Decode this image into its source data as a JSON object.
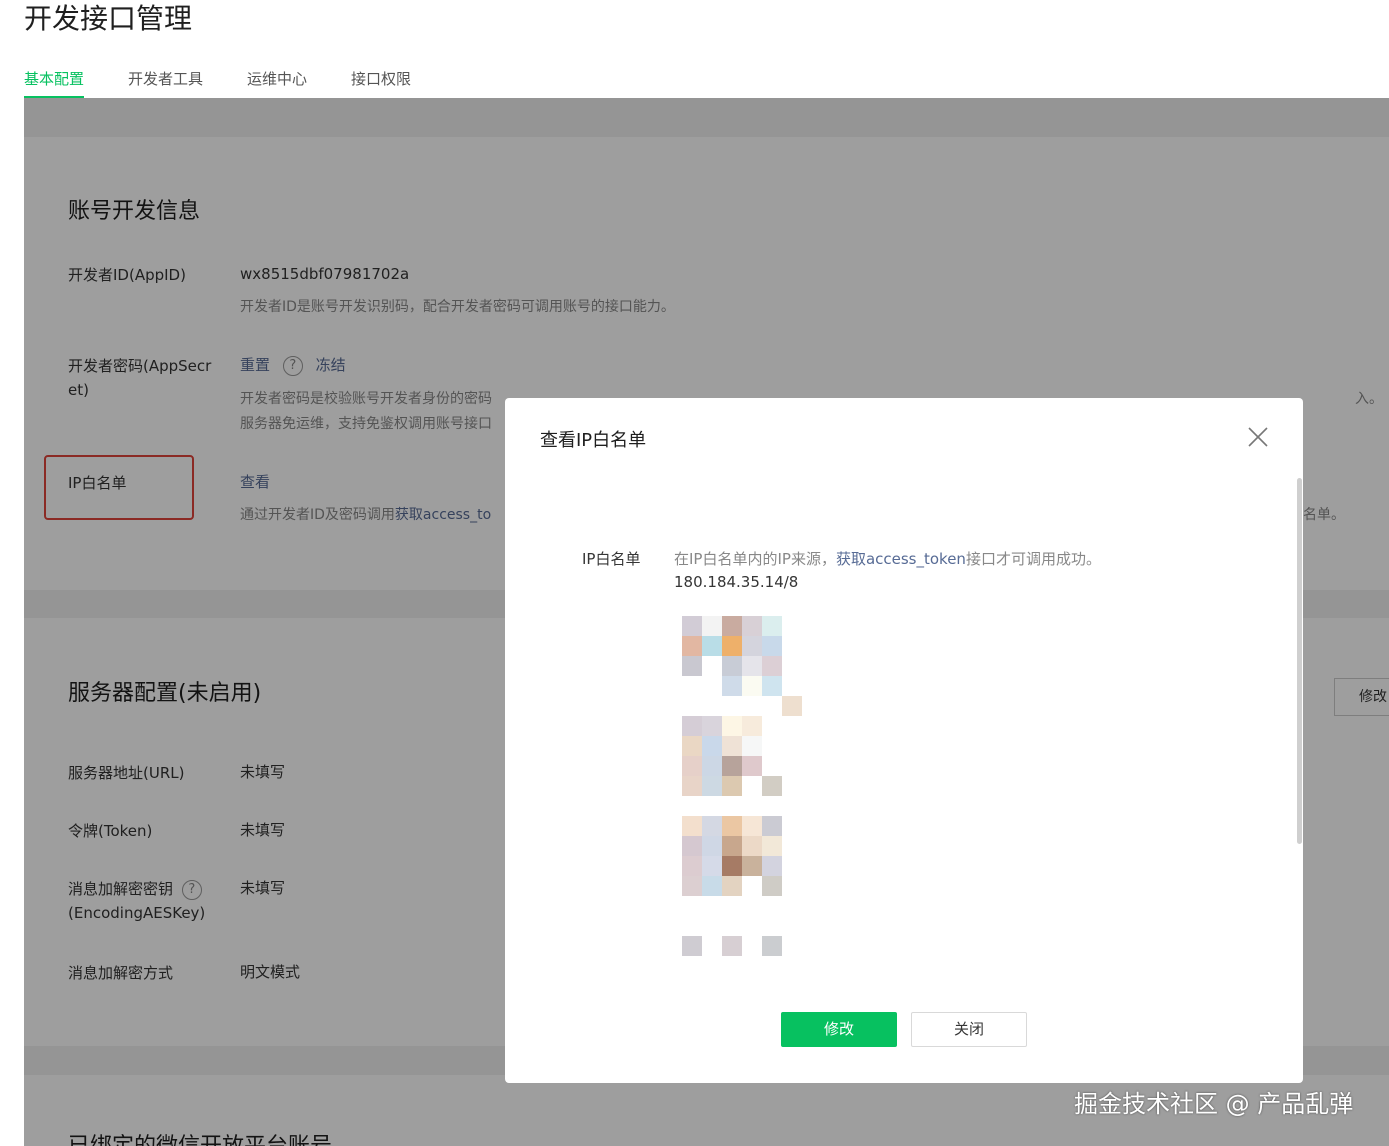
{
  "page": {
    "title": "开发接口管理",
    "tabs": [
      "基本配置",
      "开发者工具",
      "运维中心",
      "接口权限"
    ]
  },
  "account_section": {
    "title": "账号开发信息",
    "appid_label": "开发者ID(AppID)",
    "appid_value": "wx8515dbf07981702a",
    "appid_desc": "开发者ID是账号开发识别码，配合开发者密码可调用账号的接口能力。",
    "secret_label": "开发者密码(AppSecret)",
    "secret_reset": "重置",
    "secret_freeze": "冻结",
    "secret_desc1_visible": "开发者密码是校验账号开发者身份的密码",
    "secret_desc1_tail": "入。",
    "secret_desc2_visible": "服务器免运维，支持免鉴权调用账号接口",
    "ip_label": "IP白名单",
    "ip_view": "查看",
    "ip_desc_pre": "通过开发者ID及密码调用",
    "ip_desc_link": "获取access_to",
    "ip_desc_tail": "名单。"
  },
  "server_section": {
    "title": "服务器配置(未启用)",
    "modify_button": "修改",
    "url_label": "服务器地址(URL)",
    "url_value": "未填写",
    "token_label": "令牌(Token)",
    "token_value": "未填写",
    "aes_label_1": "消息加解密密钥",
    "aes_label_2": "(EncodingAESKey)",
    "aes_value": "未填写",
    "mode_label": "消息加解密方式",
    "mode_value": "明文模式"
  },
  "bound_section": {
    "title": "已绑定的微信开放平台账号"
  },
  "modal": {
    "title": "查看IP白名单",
    "ip_label": "IP白名单",
    "desc_pre": "在IP白名单内的IP来源，",
    "desc_link": "获取access_token",
    "desc_post": "接口才可调用成功。",
    "first_ip": "180.184.35.14/8",
    "modify_button": "修改",
    "close_button": "关闭"
  },
  "watermark": "掘金技术社区 @ 产品乱弹",
  "colors": {
    "accent": "#07c160",
    "link": "#576b95",
    "highlight": "#e0443a"
  }
}
